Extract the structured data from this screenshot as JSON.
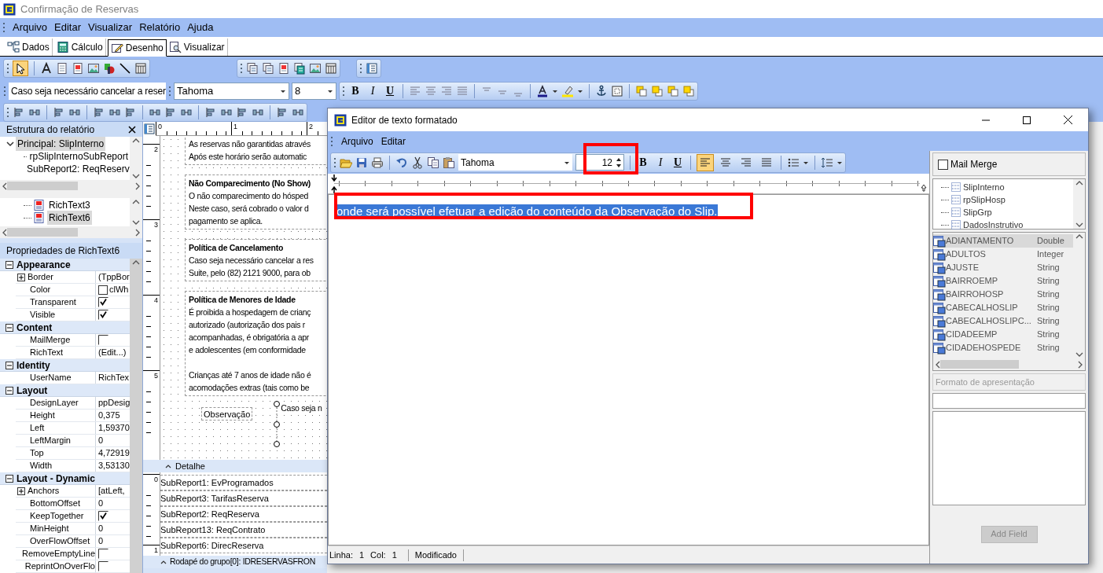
{
  "window": {
    "title": "Confirmação de Reservas"
  },
  "menu": [
    "Arquivo",
    "Editar",
    "Visualizar",
    "Relatório",
    "Ajuda"
  ],
  "tabs": [
    {
      "label": "Dados",
      "selected": false
    },
    {
      "label": "Cálculo",
      "selected": false
    },
    {
      "label": "Desenho",
      "selected": true
    },
    {
      "label": "Visualizar",
      "selected": false
    }
  ],
  "format_toolbar": {
    "text": "Caso seja necessário cancelar a reser",
    "font": "Tahoma",
    "size": "8",
    "style_buttons": [
      "B",
      "I",
      "U"
    ]
  },
  "report_tree": {
    "title": "Estrutura do relatório",
    "items": [
      {
        "label": "Principal: SlipInterno",
        "selected": true,
        "expanded": true,
        "children": [
          {
            "label": "rpSlipInternoSubReport",
            "selected": false
          },
          {
            "label": "SubReport2: ReqReserv",
            "selected": false
          }
        ]
      }
    ]
  },
  "component_tree": {
    "items": [
      {
        "label": "RichText3",
        "selected": false
      },
      {
        "label": "RichText6",
        "selected": true
      }
    ]
  },
  "properties": {
    "title": "Propriedades de RichText6",
    "groups": [
      {
        "name": "Appearance",
        "expanded": true,
        "rows": [
          {
            "name": "Border",
            "kind": "text",
            "value": "(TppBor",
            "expanded": false
          },
          {
            "name": "Color",
            "kind": "color",
            "value": "clWh"
          },
          {
            "name": "Transparent",
            "kind": "check",
            "checked": true
          },
          {
            "name": "Visible",
            "kind": "check",
            "checked": true
          }
        ]
      },
      {
        "name": "Content",
        "expanded": true,
        "rows": [
          {
            "name": "MailMerge",
            "kind": "check",
            "checked": false
          },
          {
            "name": "RichText",
            "kind": "text",
            "value": "(Edit...)"
          }
        ]
      },
      {
        "name": "Identity",
        "expanded": true,
        "rows": [
          {
            "name": "UserName",
            "kind": "text",
            "value": "RichTex"
          }
        ]
      },
      {
        "name": "Layout",
        "expanded": true,
        "rows": [
          {
            "name": "DesignLayer",
            "kind": "text",
            "value": "ppDesig"
          },
          {
            "name": "Height",
            "kind": "text",
            "value": "0,375"
          },
          {
            "name": "Left",
            "kind": "text",
            "value": "1,59370"
          },
          {
            "name": "LeftMargin",
            "kind": "text",
            "value": "0"
          },
          {
            "name": "Top",
            "kind": "text",
            "value": "4,72919"
          },
          {
            "name": "Width",
            "kind": "text",
            "value": "3,53130"
          }
        ]
      },
      {
        "name": "Layout - Dynamic",
        "expanded": true,
        "rows": [
          {
            "name": "Anchors",
            "kind": "text",
            "value": "[atLeft,",
            "expanded": false
          },
          {
            "name": "BottomOffset",
            "kind": "text",
            "value": "0"
          },
          {
            "name": "KeepTogether",
            "kind": "check",
            "checked": true
          },
          {
            "name": "MinHeight",
            "kind": "text",
            "value": "0"
          },
          {
            "name": "OverFlowOffset",
            "kind": "text",
            "value": "0"
          },
          {
            "name": "RemoveEmptyLine",
            "kind": "check",
            "checked": false
          },
          {
            "name": "ReprintOnOverFlo",
            "kind": "check",
            "checked": false
          }
        ]
      }
    ]
  },
  "report": {
    "top_ruler": [
      "0",
      "1",
      "2"
    ],
    "left_ruler": [
      "2",
      "3",
      "4",
      "5"
    ],
    "band_ruler": [
      "0",
      "1"
    ],
    "blocks": [
      {
        "paragraphs": [
          [
            "As reservas não garantidas através",
            "Após este horário serão automatic"
          ]
        ]
      },
      {
        "heading": "Não Comparecimento (No Show)",
        "paragraphs": [
          [
            "O não comparecimento do hósped",
            "Neste caso, será cobrado o valor d",
            "pagamento se aplica."
          ]
        ]
      },
      {
        "heading": "Política de Cancelamento",
        "paragraphs": [
          [
            "Caso seja necessário cancelar a res",
            "Suite, pelo (82) 2121 9000, para ob"
          ]
        ]
      },
      {
        "heading": "Política de Menores de Idade",
        "paragraphs": [
          [
            "É proibida a hospedagem de crianç",
            "autorizado (autorização dos pais r",
            "acompanhadas, é obrigatória a apr",
            "e adolescentes (em conformidade"
          ],
          [
            "Crianças até 7 anos de idade não é",
            "acomodações extras (tais como be"
          ]
        ]
      }
    ],
    "label": "Observação",
    "rich_text": "Caso seja n",
    "band": "Detalhe",
    "subreports": [
      "SubReport1: EvProgramados",
      "SubReport3: TarifasReserva",
      "SubReport2: ReqReserva",
      "SubReport13: ReqContrato",
      "SubReport6: DirecReserva"
    ],
    "footer": "Rodapé do grupo[0]: IDRESERVASFRON"
  },
  "editor": {
    "title": "Editor de texto formatado",
    "menu": [
      "Arquivo",
      "Editar"
    ],
    "font": "Tahoma",
    "size": "12",
    "style_buttons": [
      "B",
      "I",
      "U"
    ],
    "alignments": [
      {
        "kind": "left",
        "selected": true
      },
      {
        "kind": "center",
        "selected": false
      },
      {
        "kind": "right",
        "selected": false
      },
      {
        "kind": "justify",
        "selected": false
      }
    ],
    "text": "onde será possível efetuar a edição do conteúdo da Observação do Slip.",
    "text_selected": true,
    "mail_merge": {
      "label": "Mail Merge",
      "checked": false
    },
    "datasets": [
      "SlipInterno",
      "rpSlipHosp",
      "SlipGrp",
      "DadosInstrutivo"
    ],
    "fields": [
      {
        "name": "ADIANTAMENTO",
        "type": "Double",
        "selected": true
      },
      {
        "name": "ADULTOS",
        "type": "Integer",
        "selected": false
      },
      {
        "name": "AJUSTE",
        "type": "String",
        "selected": false
      },
      {
        "name": "BAIRROEMP",
        "type": "String",
        "selected": false
      },
      {
        "name": "BAIRROHOSP",
        "type": "String",
        "selected": false
      },
      {
        "name": "CABECALHOSLIP",
        "type": "String",
        "selected": false
      },
      {
        "name": "CABECALHOSLIPC...",
        "type": "String",
        "selected": false
      },
      {
        "name": "CIDADEEMP",
        "type": "String",
        "selected": false
      },
      {
        "name": "CIDADEHOSPEDE",
        "type": "String",
        "selected": false
      }
    ],
    "format_label": "Formato de apresentação",
    "add_button": {
      "label": "Add Field",
      "disabled": true
    },
    "status": [
      {
        "label": "Linha:",
        "value": "1"
      },
      {
        "label": "Col:",
        "value": "1"
      }
    ],
    "status_state": "Modificado"
  }
}
